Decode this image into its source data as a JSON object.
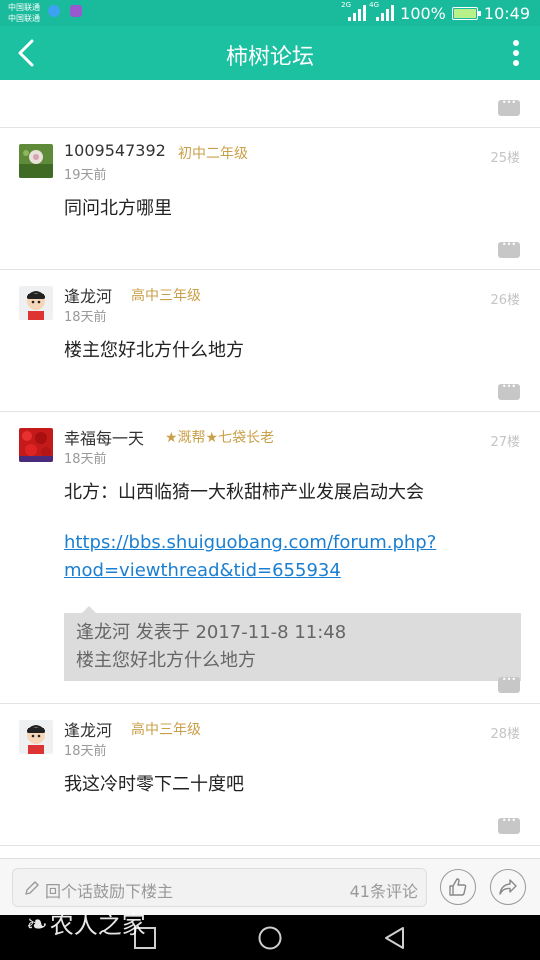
{
  "status_bar": {
    "carrier_1": "中国联通",
    "carrier_2": "中国联通",
    "signal_1_tag": "2G",
    "signal_2_tag": "4G",
    "battery": "100%",
    "time": "10:49"
  },
  "app_bar": {
    "title": "柿树论坛"
  },
  "posts": [
    {
      "username": "1009547392",
      "rank": "初中二年级",
      "time": "19天前",
      "floor": "25楼",
      "text": "同问北方哪里"
    },
    {
      "username": "逢龙河",
      "rank": "高中三年级",
      "time": "18天前",
      "floor": "26楼",
      "text": "楼主您好北方什么地方"
    },
    {
      "username": "幸福每一天",
      "rank": "★溉帮★七袋长老",
      "time": "18天前",
      "floor": "27楼",
      "text": "北方：山西临猗一大秋甜柿产业发展启动大会",
      "link_line1": "https://bbs.shuiguobang.com/forum.php?",
      "link_line2": "mod=viewthread&tid=655934",
      "quote_header": "逢龙河 发表于 2017-11-8 11:48",
      "quote_text": "楼主您好北方什么地方"
    },
    {
      "username": "逢龙河",
      "rank": "高中三年级",
      "time": "18天前",
      "floor": "28楼",
      "text": "我这冷时零下二十度吧"
    }
  ],
  "input_bar": {
    "placeholder": "回个话鼓励下楼主",
    "comment_count": "41条评论"
  },
  "watermark": "农人之家",
  "colors": {
    "accent": "#1cc1a2",
    "rank": "#c9a04a",
    "link": "#1a7fd1"
  }
}
